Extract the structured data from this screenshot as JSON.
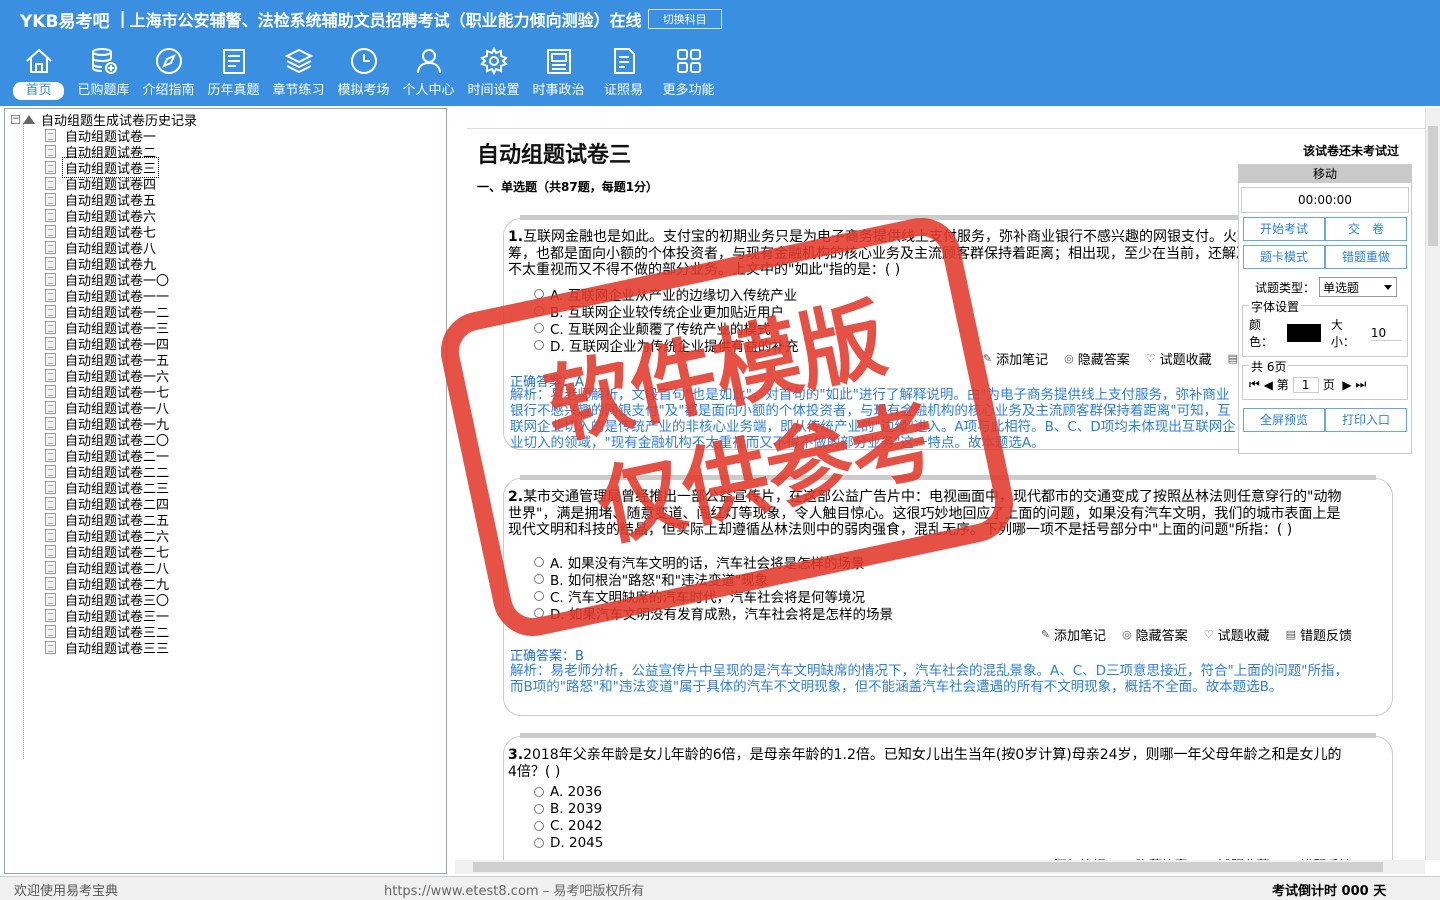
{
  "header": {
    "brand": "YKB易考吧",
    "sep": "|",
    "title": "上海市公安辅警、法检系统辅助文员招聘考试（职业能力倾向测验）在线",
    "switch_label": "切换科目"
  },
  "nav": [
    {
      "label": "首页",
      "icon": "home-icon"
    },
    {
      "label": "已购题库",
      "icon": "database-icon"
    },
    {
      "label": "介绍指南",
      "icon": "compass-icon"
    },
    {
      "label": "历年真题",
      "icon": "list-icon"
    },
    {
      "label": "章节练习",
      "icon": "layers-icon"
    },
    {
      "label": "模拟考场",
      "icon": "clock-icon"
    },
    {
      "label": "个人中心",
      "icon": "user-icon"
    },
    {
      "label": "时间设置",
      "icon": "gear-icon"
    },
    {
      "label": "时事政治",
      "icon": "news-icon"
    },
    {
      "label": "证照易",
      "icon": "document-icon"
    },
    {
      "label": "更多功能",
      "icon": "grid-icon"
    }
  ],
  "tree": {
    "root_label": "自动组题生成试卷历史记录",
    "items": [
      "自动组题试卷一",
      "自动组题试卷二",
      "自动组题试卷三",
      "自动组题试卷四",
      "自动组题试卷五",
      "自动组题试卷六",
      "自动组题试卷七",
      "自动组题试卷八",
      "自动组题试卷九",
      "自动组题试卷一〇",
      "自动组题试卷一一",
      "自动组题试卷一二",
      "自动组题试卷一三",
      "自动组题试卷一四",
      "自动组题试卷一五",
      "自动组题试卷一六",
      "自动组题试卷一七",
      "自动组题试卷一八",
      "自动组题试卷一九",
      "自动组题试卷二〇",
      "自动组题试卷二一",
      "自动组题试卷二二",
      "自动组题试卷二三",
      "自动组题试卷二四",
      "自动组题试卷二五",
      "自动组题试卷二六",
      "自动组题试卷二七",
      "自动组题试卷二八",
      "自动组题试卷二九",
      "自动组题试卷三〇",
      "自动组题试卷三一",
      "自动组题试卷三二",
      "自动组题试卷三三"
    ],
    "selected_index": 2
  },
  "paper": {
    "title": "自动组题试卷三",
    "status": "该试卷还未考试过",
    "section": "一、单选题（共87题，每题1分）"
  },
  "questions": [
    {
      "num": "1.",
      "stem": "互联网金融也是如此。支付宝的初期业务只是为电子商务提供线上支付服务，弥补商业银行不感兴趣的网银支付。火朝天的P2P和众筹，也都是面向小额的个体投资者，与现有金融机构的核心业务及主流顾客群保持着距离；相出现，至少在当前，还解决了现有金融机构不太重视而又不得不做的部分业务。上文中的\"如此\"指的是：( )",
      "options": [
        "A. 互联网企业从产业的边缘切入传统产业",
        "B. 互联网企业较传统企业更加贴近用户",
        "C. 互联网企业颠覆了传统产业的模式",
        "D. 互联网企业为传统企业提供有益的补充"
      ],
      "answer": "正确答案：A",
      "analysis": "解析：易老师解析，文段首句\"也是如此\"，对首句的\"如此\"进行了解释说明。由\"为电子商务提供线上支付服务，弥补商业银行不感兴趣的网银支付\"及\"都是面向小额的个体投资者，与现有金融机构的核心业务及主流顾客群保持着距离\"可知，互联网企业切入的是传统产业的非核心业务端，即从传统产业的\"边缘\"进入。A项与此相符。B、C、D项均未体现出互联网企业切入的领域，\"现有金融机构不太重视而又不得不做的部分业务\"这一特点。故本题选A。"
    },
    {
      "num": "2.",
      "stem": "某市交通管理局曾经推出一部公益宣传片，在这部公益广告片中：电视画面中，现代都市的交通变成了按照丛林法则任意穿行的\"动物世界\"，满是拥堵、随意变道、闯红灯等现象，令人触目惊心。这很巧妙地回应了上面的问题，如果没有汽车文明，我们的城市表面上是现代文明和科技的结晶，但实际上却遵循丛林法则中的弱肉强食，混乱无序。下列哪一项不是括号部分中\"上面的问题\"所指：( )",
      "options": [
        "A. 如果没有汽车文明的话，汽车社会将是怎样的场景",
        "B. 如何根治\"路怒\"和\"违法变道\"现象",
        "C. 汽车文明缺席的汽车时代，汽车社会将是何等境况",
        "D. 如果汽车文明没有发育成熟，汽车社会将是怎样的场景"
      ],
      "answer": "正确答案：B",
      "analysis": "解析：易老师分析，公益宣传片中呈现的是汽车文明缺席的情况下，汽车社会的混乱景象。A、C、D三项意思接近，符合\"上面的问题\"所指，而B项的\"路怒\"和\"违法变道\"属于具体的汽车不文明现象，但不能涵盖汽车社会遭遇的所有不文明现象，概括不全面。故本题选B。"
    },
    {
      "num": "3.",
      "stem": "2018年父亲年龄是女儿年龄的6倍，是母亲年龄的1.2倍。已知女儿出生当年(按0岁计算)母亲24岁，则哪一年父母年龄之和是女儿的4倍？( )",
      "options": [
        "A. 2036",
        "B. 2039",
        "C. 2042",
        "D. 2045"
      ]
    }
  ],
  "actions": {
    "add_note": "添加笔记",
    "hide_answer": "隐藏答案",
    "favorite": "试题收藏",
    "feedback": "错题反馈"
  },
  "panel": {
    "move": "移动",
    "timer": "00:00:00",
    "start_exam": "开始考试",
    "submit": "交　卷",
    "card_mode": "题卡模式",
    "redo_wrong": "错题重做",
    "type_label": "试题类型：",
    "type_value": "单选题",
    "font_group": "字体设置",
    "color_label": "颜色：",
    "size_label": "大小：",
    "size_value": "10",
    "pages_label": "共 6页",
    "page_prefix": "第",
    "page_value": "1",
    "page_suffix": "页",
    "fullscreen": "全屏预览",
    "print": "打印入口"
  },
  "status": {
    "left": "欢迎使用易考宝典",
    "mid": "https://www.etest8.com – 易考吧版权所有",
    "right": "考试倒计时 000 天"
  },
  "watermark": {
    "line1": "软件模版",
    "line2": "仅供参考"
  }
}
